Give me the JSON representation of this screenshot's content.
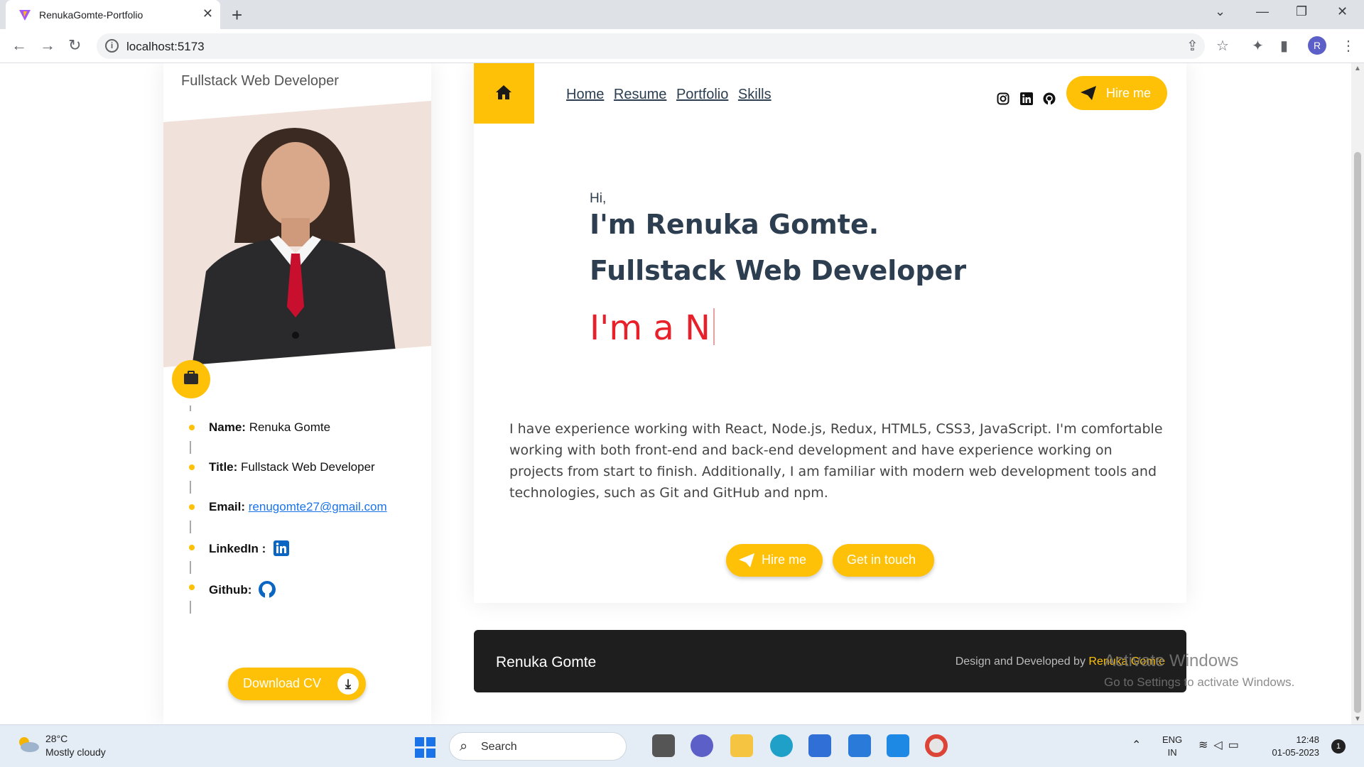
{
  "browser": {
    "tab_title": "RenukaGomte-Portfolio",
    "url": "localhost:5173",
    "profile_initial": "R"
  },
  "sidebar": {
    "role": "Fullstack Web Developer",
    "info": [
      {
        "label": "Name:",
        "value": "Renuka Gomte"
      },
      {
        "label": "Title:",
        "value": "Fullstack Web Developer"
      },
      {
        "label": "Email:",
        "value": "renugomte27@gmail.com"
      },
      {
        "label": "LinkedIn :",
        "value": ""
      },
      {
        "label": "Github:",
        "value": ""
      }
    ],
    "download_cv": "Download CV"
  },
  "nav": {
    "links": [
      "Home",
      "Resume",
      "Portfolio",
      "Skills"
    ],
    "hire_me": "Hire me"
  },
  "hero": {
    "greeting": "Hi,",
    "name": "I'm Renuka Gomte.",
    "title": "Fullstack Web Developer",
    "typing": "I'm a N",
    "about": "I have experience working with React, Node.js, Redux, HTML5, CSS3, JavaScript. I'm comfortable working with both front-end and back-end development and have experience working on projects from start to finish. Additionally, I am familiar with modern web development tools and technologies, such as Git and GitHub and npm.",
    "hire_me": "Hire me",
    "get_in_touch": "Get in touch"
  },
  "footer": {
    "name": "Renuka Gomte",
    "credit_prefix": "Design and Developed by",
    "credit_name": "Renuka Gomte"
  },
  "watermark": {
    "line1": "Activate Windows",
    "line2": "Go to Settings to activate Windows."
  },
  "taskbar": {
    "temperature": "28°C",
    "weather": "Mostly cloudy",
    "search_placeholder": "Search",
    "lang1": "ENG",
    "lang2": "IN",
    "time": "12:48",
    "date": "01-05-2023",
    "notifications": "1"
  },
  "colors": {
    "accent": "#ffc107",
    "heading": "#2c3e50",
    "typing": "#e8202a",
    "footer_bg": "#1e1e1e"
  }
}
